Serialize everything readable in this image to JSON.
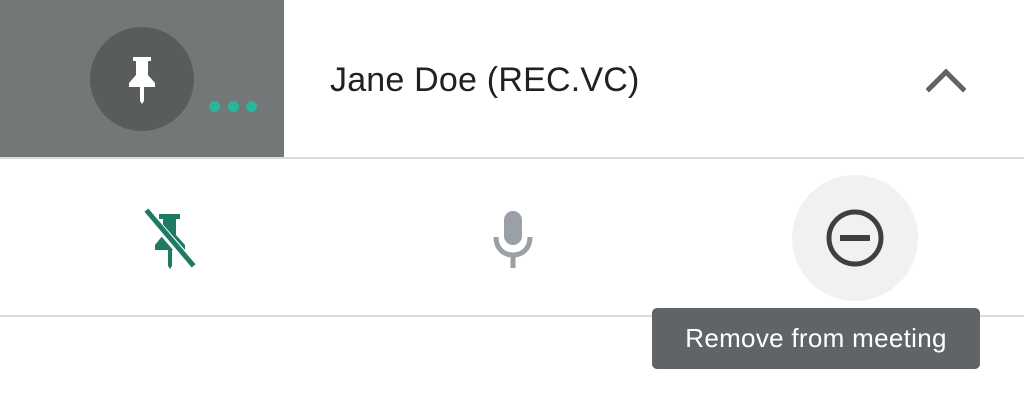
{
  "participant": {
    "name": "Jane Doe (REC.VC)",
    "speaking_indicator_color": "#2bb59a"
  },
  "icons": {
    "tile_pin": "pin-icon",
    "collapse": "chevron-up-icon",
    "unpin": "unpin-icon",
    "mic": "microphone-icon",
    "remove": "remove-circle-icon"
  },
  "colors": {
    "tile_background": "#747778",
    "accent_green": "#1e7a64",
    "icon_grey": "#9aa0a6",
    "tooltip_background": "#606367"
  },
  "tooltip": {
    "text": "Remove from meeting"
  }
}
